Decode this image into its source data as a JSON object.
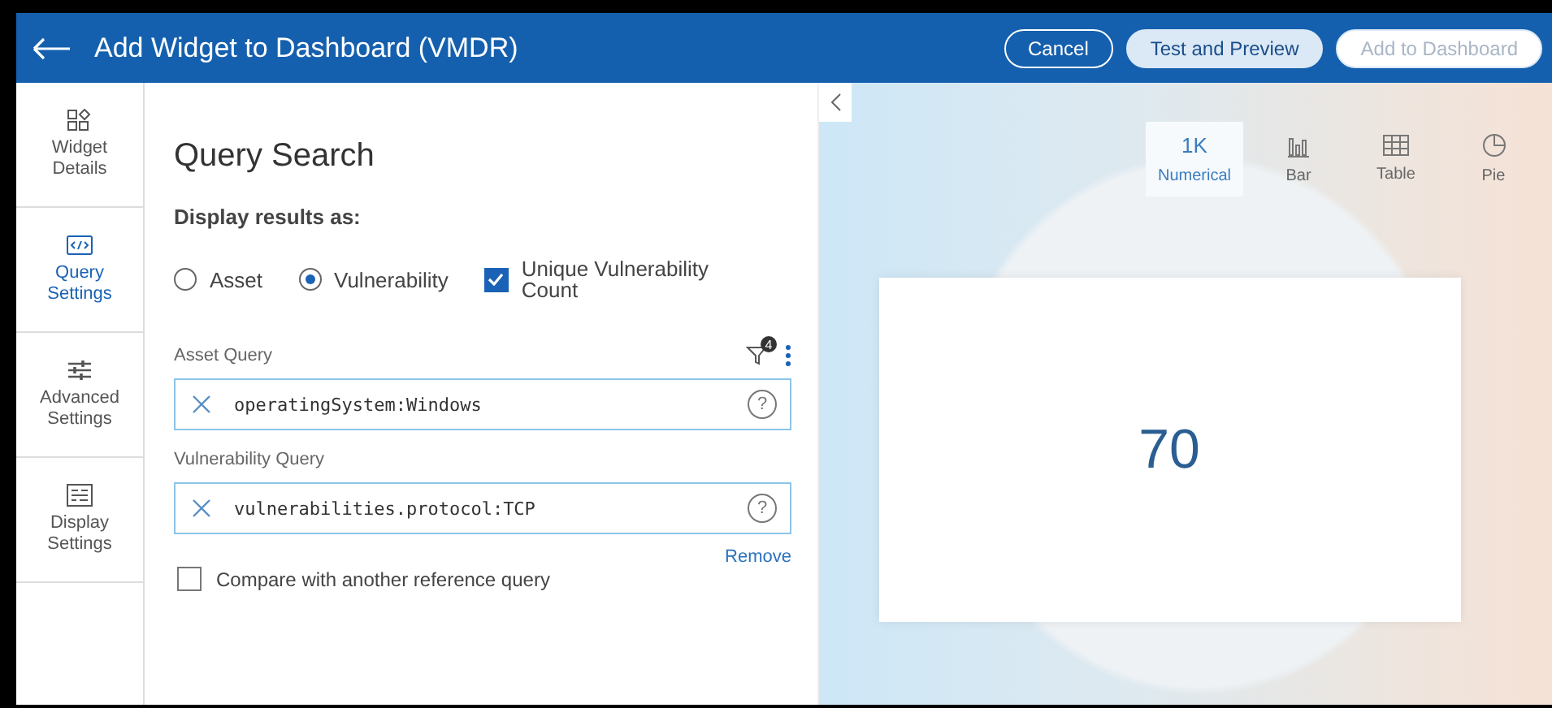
{
  "window": {
    "title": "Add Widget to Dashboard (VMDR)"
  },
  "header_buttons": [
    {
      "label": "Cancel",
      "kind": "outline",
      "disabled": false
    },
    {
      "label": "Test and Preview",
      "kind": "filled",
      "disabled": false
    },
    {
      "label": "Add to Dashboard",
      "kind": "filled",
      "disabled": true
    }
  ],
  "sidebar": {
    "items": [
      {
        "label": "Widget Details",
        "selected": false
      },
      {
        "label": "Query Settings",
        "selected": true
      },
      {
        "label": "Advanced Settings",
        "selected": false
      },
      {
        "label": "Display Settings",
        "selected": false
      }
    ]
  },
  "form": {
    "title": "Query Search",
    "display_label": "Display results as:",
    "options": [
      {
        "label": "Asset",
        "kind": "radio",
        "selected": false
      },
      {
        "label": "Vulnerability",
        "kind": "radio",
        "selected": true
      },
      {
        "label": "Unique Vulnerability Count",
        "kind": "checkbox",
        "checked": true
      }
    ],
    "filter_count": "4",
    "queries": [
      {
        "label": "Asset Query",
        "value": "operatingSystem:Windows",
        "help": "?"
      },
      {
        "label": "Vulnerability Query",
        "value": "vulnerabilities.protocol:TCP",
        "help": "?"
      }
    ],
    "remove_link": "Remove",
    "compare": {
      "label": "Compare with another reference query",
      "checked": false
    }
  },
  "preview": {
    "chart_types": [
      {
        "label": "Numerical",
        "icon_text": "1K",
        "selected": true
      },
      {
        "label": "Bar",
        "selected": false
      },
      {
        "label": "Table",
        "selected": false
      },
      {
        "label": "Pie",
        "selected": false
      }
    ],
    "value": "70"
  }
}
